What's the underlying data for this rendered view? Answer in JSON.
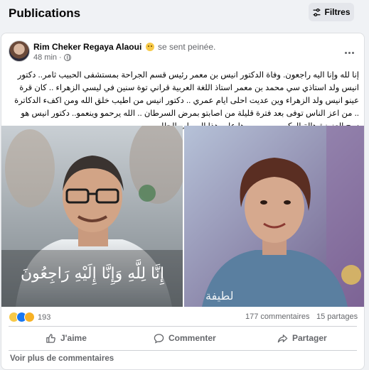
{
  "header": {
    "title": "Publications",
    "filter_label": "Filtres"
  },
  "post": {
    "author": "Rim Cheker Regaya Alaoui",
    "feeling": "se sent peinée.",
    "time": "48 min",
    "text": "إنا لله وإنا اليه راجعون. وفاة الدكتور انيس بن معمر رئيس قسم الجراحة بمستشفى الحبيب ثامر.. دكتور انيس ولد استاذي سي محمد بن معمر استاذ اللغة العربية قراني توة سنين في ليسي الزهراء .. كان قرة عينو انيس ولد الزهراء وين عديت احلى ايام عمري .. دكتور انيس من اطيب خلق الله ومن اكفء الدكاترة .. من اعز الناس توفى بعد فترة قليلة من اصابتو بمرض السرطان .. الله يرحمو وينعمو.. دكتور انيس هو زوج العزيزة هالة الركبي ربي يصبرها على هذا المصاب الجلل .",
    "photo_left_caption": "إِنَّا لِلَّهِ وَإِنَّا إِلَيْهِ رَاجِعُونَ",
    "photo_right_watermark": "لطيفة",
    "reaction_count": "193",
    "comments": "177 commentaires",
    "shares": "15 partages"
  },
  "actions": {
    "like": "J'aime",
    "comment": "Commenter",
    "share": "Partager"
  },
  "more_comments": "Voir plus de commentaires",
  "colors": {
    "background": "#f0f2f5",
    "card": "#ffffff",
    "muted": "#65676b",
    "brand": "#1877f2"
  },
  "icons": [
    "sliders-icon",
    "globe-icon",
    "more-icon",
    "like-icon",
    "comment-icon",
    "share-icon"
  ]
}
